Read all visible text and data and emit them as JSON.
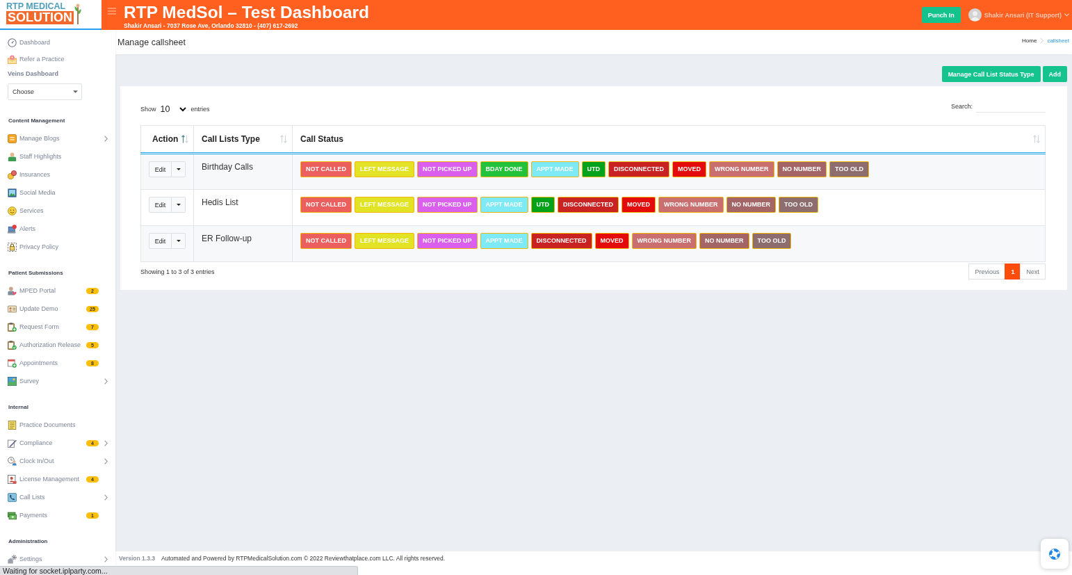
{
  "header": {
    "logo": {
      "line1": "RTP MEDICAL",
      "line2": "SOLUTION"
    },
    "title": "RTP MedSol – Test Dashboard",
    "subtitle": "Shakir Ansari - 7037 Rose Ave, Orlando 32810 - (407) 617-2692",
    "punch_button": "Punch In",
    "user": "Shakir Ansari (IT Support)"
  },
  "sidebar": {
    "top_items": [
      {
        "label": "Dashboard"
      },
      {
        "label": "Refer a Practice"
      }
    ],
    "veins": {
      "label": "Veins Dashboard",
      "select": "Choose"
    },
    "sections": [
      {
        "title": "Content Management",
        "items": [
          {
            "label": "Manage Blogs",
            "submenu": true
          },
          {
            "label": "Staff Highlights",
            "submenu": false
          },
          {
            "label": "Insurances",
            "submenu": false
          },
          {
            "label": "Social Media",
            "submenu": false
          },
          {
            "label": "Services",
            "submenu": false
          },
          {
            "label": "Alerts",
            "submenu": false
          },
          {
            "label": "Privacy Policy",
            "submenu": false
          }
        ]
      },
      {
        "title": "Patient Submissions",
        "items": [
          {
            "label": "MPED Portal",
            "badge": "2",
            "submenu": false
          },
          {
            "label": "Update Demo",
            "badge": "25",
            "submenu": false
          },
          {
            "label": "Request Form",
            "badge": "7",
            "submenu": false
          },
          {
            "label": "Authorization Release",
            "badge": "5",
            "submenu": false
          },
          {
            "label": "Appointments",
            "badge": "8",
            "submenu": false
          },
          {
            "label": "Survey",
            "submenu": true
          }
        ]
      },
      {
        "title": "Internal",
        "items": [
          {
            "label": "Practice Documents",
            "submenu": false
          },
          {
            "label": "Compliance",
            "badge": "4",
            "submenu": true
          },
          {
            "label": "Clock In/Out",
            "submenu": true
          },
          {
            "label": "License Management",
            "badge": "4",
            "submenu": false
          },
          {
            "label": "Call Lists",
            "submenu": true
          },
          {
            "label": "Payments",
            "badge": "1",
            "submenu": false
          }
        ]
      },
      {
        "title": "Administration",
        "items": [
          {
            "label": "Settings",
            "submenu": true
          }
        ]
      }
    ]
  },
  "page": {
    "title": "Manage callsheet",
    "breadcrumb": [
      {
        "label": "Home",
        "current": false
      },
      {
        "label": "callsheet",
        "current": true
      }
    ]
  },
  "toolbar": {
    "buttons": [
      "Manage Call List Status Type",
      "Add"
    ]
  },
  "table": {
    "length": {
      "before": "Show",
      "value": "10",
      "after": "entries"
    },
    "search": {
      "label": "Search:"
    },
    "columns": [
      {
        "label": "Action",
        "sorted": true
      },
      {
        "label": "Call Lists Type",
        "sorted": false
      },
      {
        "label": "Call Status",
        "sorted": false
      }
    ],
    "rows": [
      {
        "action": "Edit",
        "type": "Birthday Calls",
        "statuses": [
          {
            "label": "NOT CALLED",
            "color": "#ec5f5f"
          },
          {
            "label": "LEFT MESSAGE",
            "color": "#e3e325"
          },
          {
            "label": "NOT PICKED UP",
            "color": "#d95fec"
          },
          {
            "label": "BDAY DONE",
            "color": "#22c33b"
          },
          {
            "label": "APPT MADE",
            "color": "#7eeaf6"
          },
          {
            "label": "UTD",
            "color": "#03a21b"
          },
          {
            "label": "DISCONNECTED",
            "color": "#c92222"
          },
          {
            "label": "MOVED",
            "color": "#e30b0b"
          },
          {
            "label": "WRONG NUMBER",
            "color": "#c96f6f"
          },
          {
            "label": "NO NUMBER",
            "color": "#a36565"
          },
          {
            "label": "TOO OLD",
            "color": "#8e6d6f"
          }
        ]
      },
      {
        "action": "Edit",
        "type": "Hedis List",
        "statuses": [
          {
            "label": "NOT CALLED",
            "color": "#ec5f5f"
          },
          {
            "label": "LEFT MESSAGE",
            "color": "#e3e325"
          },
          {
            "label": "NOT PICKED UP",
            "color": "#d95fec"
          },
          {
            "label": "APPT MADE",
            "color": "#7eeaf6"
          },
          {
            "label": "UTD",
            "color": "#03a21b"
          },
          {
            "label": "DISCONNECTED",
            "color": "#c92222"
          },
          {
            "label": "MOVED",
            "color": "#e30b0b"
          },
          {
            "label": "WRONG NUMBER",
            "color": "#c96f6f"
          },
          {
            "label": "NO NUMBER",
            "color": "#a36565"
          },
          {
            "label": "TOO OLD",
            "color": "#8e6d6f"
          }
        ]
      },
      {
        "action": "Edit",
        "type": "ER Follow-up",
        "statuses": [
          {
            "label": "NOT CALLED",
            "color": "#ec5f5f"
          },
          {
            "label": "LEFT MESSAGE",
            "color": "#e3e325"
          },
          {
            "label": "NOT PICKED UP",
            "color": "#d95fec"
          },
          {
            "label": "APPT MADE",
            "color": "#7eeaf6"
          },
          {
            "label": "DISCONNECTED",
            "color": "#c92222"
          },
          {
            "label": "MOVED",
            "color": "#e30b0b"
          },
          {
            "label": "WRONG NUMBER",
            "color": "#c96f6f"
          },
          {
            "label": "NO NUMBER",
            "color": "#a36565"
          },
          {
            "label": "TOO OLD",
            "color": "#8e6d6f"
          }
        ]
      }
    ],
    "info": "Showing 1 to 3 of 3 entries",
    "pagination": [
      {
        "label": "Previous",
        "selected": false
      },
      {
        "label": "1",
        "selected": true
      },
      {
        "label": "Next",
        "selected": false
      }
    ]
  },
  "footer": {
    "version": "Version 1.3.3",
    "text": "Automated and Powered by RTPMedicalSolution.com © 2022 Reviewthatplace.com LLC. All rights reserved."
  },
  "browser_status": "Waiting for socket.iplparty.com..."
}
